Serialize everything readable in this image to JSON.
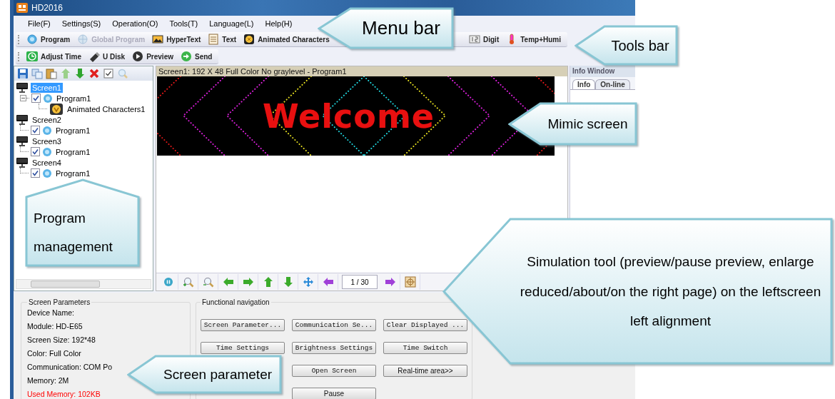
{
  "window": {
    "title": "HD2016"
  },
  "menu_bar": [
    "File(F)",
    "Settings(S)",
    "Operation(O)",
    "Tools(T)",
    "Language(L)",
    "Help(H)"
  ],
  "toolbar": [
    {
      "label": "Program",
      "disabled": false
    },
    {
      "label": "Global Program",
      "disabled": true
    },
    {
      "label": "HyperText",
      "disabled": false
    },
    {
      "label": "Text",
      "disabled": false
    },
    {
      "label": "Animated Characters",
      "disabled": false
    },
    {
      "label": "Digit",
      "disabled": false
    },
    {
      "label": "Temp+Humi",
      "disabled": false
    }
  ],
  "toolbar_2": [
    {
      "label": "Adjust Time"
    },
    {
      "label": "U Disk"
    },
    {
      "label": "Preview"
    },
    {
      "label": "Send"
    }
  ],
  "program_tree": [
    {
      "kind": "screen",
      "label": "Screen1",
      "selected": true,
      "children": [
        {
          "kind": "program",
          "label": "Program1",
          "checked": true,
          "children": [
            {
              "kind": "item",
              "label": "Animated Characters1"
            }
          ]
        }
      ]
    },
    {
      "kind": "screen",
      "label": "Screen2",
      "selected": false,
      "children": [
        {
          "kind": "program",
          "label": "Program1",
          "checked": true
        }
      ]
    },
    {
      "kind": "screen",
      "label": "Screen3",
      "selected": false,
      "children": [
        {
          "kind": "program",
          "label": "Program1",
          "checked": true
        }
      ]
    },
    {
      "kind": "screen",
      "label": "Screen4",
      "selected": false,
      "children": [
        {
          "kind": "program",
          "label": "Program1",
          "checked": true
        }
      ]
    }
  ],
  "preview": {
    "caption": "Screen1: 192 X 48  Full Color No graylevel - Program1",
    "led_text": "Welcome"
  },
  "navigation": {
    "page": "1 / 30"
  },
  "info_window": {
    "title": "Info Window",
    "tabs": [
      {
        "label": "Info",
        "selected": true
      },
      {
        "label": "On-line",
        "selected": false
      }
    ]
  },
  "screen_parameters": {
    "title": "Screen Parameters",
    "lines": [
      {
        "text": "Device Name:",
        "kind": "normal"
      },
      {
        "text": "Module: HD-E65",
        "kind": "normal"
      },
      {
        "text": "Screen Size: 192*48",
        "kind": "normal"
      },
      {
        "text": "Color: Full Color",
        "kind": "normal"
      },
      {
        "text": "Communication: COM Po",
        "kind": "normal"
      },
      {
        "text": "Memory: 2M",
        "kind": "normal"
      },
      {
        "text": "Used Memory: 102KB",
        "kind": "alert"
      }
    ]
  },
  "functional_navigation": {
    "title": "Functional navigation",
    "rows": [
      [
        {
          "label": "Screen Parameter...",
          "kind": "mono"
        },
        {
          "label": "Communication Se...",
          "kind": "mono"
        },
        {
          "label": "Clear Displayed ...",
          "kind": "mono"
        }
      ],
      [
        {
          "label": "Time Settings",
          "kind": "mono"
        },
        {
          "label": "Brightness Settings",
          "kind": "mono"
        },
        {
          "label": "Time Switch",
          "kind": "mono"
        }
      ],
      [
        "",
        {
          "label": "Open Screen",
          "kind": "mono"
        },
        {
          "label": "Real-time area>>",
          "kind": "sans"
        }
      ],
      [
        "",
        {
          "label": "Pause",
          "kind": "sans"
        }
      ]
    ]
  },
  "callouts": [
    {
      "text": "Menu bar"
    },
    {
      "text": "Tools bar"
    },
    {
      "text": "Mimic screen"
    },
    {
      "text": "Program management"
    },
    {
      "text": "Simulation tool (preview/pause preview, enlarge reduced/about/on the right page) on the leftscreen left alignment"
    },
    {
      "text": "Screen parameter"
    }
  ]
}
